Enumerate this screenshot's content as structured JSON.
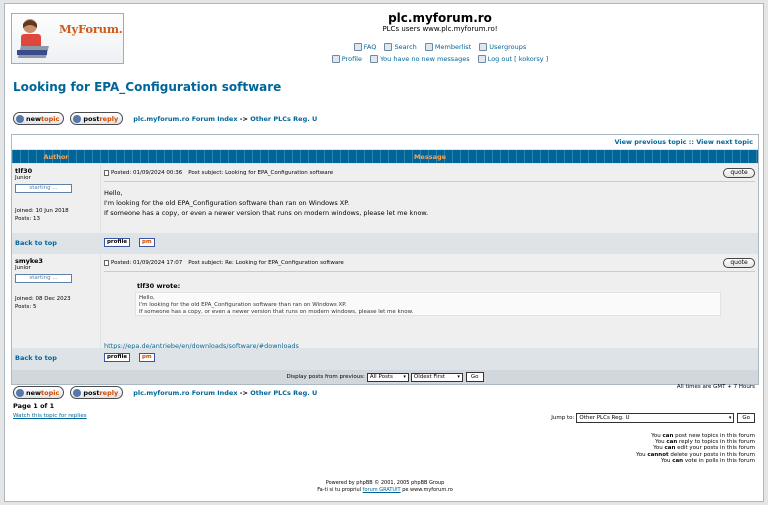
{
  "header": {
    "logo_text": "MyForum.ro",
    "site_title": "plc.myforum.ro",
    "site_description": "PLCs users www.plc.myforum.ro!",
    "nav_row1": [
      {
        "label": "FAQ",
        "icon": "faq-icon"
      },
      {
        "label": "Search",
        "icon": "search-icon"
      },
      {
        "label": "Memberlist",
        "icon": "memberlist-icon"
      },
      {
        "label": "Usergroups",
        "icon": "usergroups-icon"
      }
    ],
    "nav_row2": [
      {
        "label": "Profile",
        "icon": "profile-icon"
      },
      {
        "label": "You have no new messages",
        "icon": "messages-icon"
      },
      {
        "label": "Log out [ kokorsy ]",
        "icon": "logout-icon"
      }
    ]
  },
  "topic": {
    "title": "Looking for EPA_Configuration software",
    "newtopic_label": "newtopic",
    "newtopic_prefix": "new",
    "newtopic_suffix": "topic",
    "postreply_prefix": "post",
    "postreply_suffix": "reply"
  },
  "breadcrumb": {
    "index": "plc.myforum.ro Forum Index",
    "separator": "->",
    "forum": "Other PLCs Reg. U"
  },
  "table": {
    "view_previous": "View previous topic",
    "separator": "::",
    "view_next": "View next topic",
    "col_author": "Author",
    "col_message": "Message"
  },
  "posts": [
    {
      "author": "tlf30",
      "rank": "Junior",
      "rank_badge": "starting ...",
      "joined": "Joined: 10 Jun 2018",
      "posts": "Posts: 13",
      "posted": "Posted: 01/09/2024 00:36",
      "subject": "Post subject: Looking for EPA_Configuration software",
      "lines": [
        "Hello,",
        "I'm looking for the old EPA_Configuration software than ran on Windows XP.",
        "If someone has a copy, or even a newer version that runs on modern windows, please let me know."
      ]
    },
    {
      "author": "smyke3",
      "rank": "Junior",
      "rank_badge": "starting ...",
      "joined": "Joined: 08 Dec 2023",
      "posts": "Posts: 5",
      "posted": "Posted: 01/09/2024 17:07",
      "subject": "Post subject: Re: Looking for EPA_Configuration software",
      "quote_author": "tlf30 wrote:",
      "quote_lines": [
        "Hello,",
        "I'm looking for the old EPA_Configuration software than ran on Windows XP.",
        "If someone has a copy, or even a newer version that runs on modern windows, please let me know."
      ],
      "link": "https://epa.de/antriebe/en/downloads/software/#downloads"
    }
  ],
  "post_actions": {
    "quote": "quote",
    "profile": "profile",
    "pm": "pm",
    "back_to_top": "Back to top"
  },
  "display": {
    "label": "Display posts from previous:",
    "posts_option": "All Posts",
    "order_option": "Oldest First",
    "go": "Go"
  },
  "bottom": {
    "timezone": "All times are GMT + 7 Hours",
    "page_info": "Page 1 of 1",
    "watch": "Watch this topic for replies",
    "jump_label": "Jump to:",
    "jump_option": "Other PLCs Reg. U",
    "go": "Go"
  },
  "permissions": [
    {
      "pre": "You ",
      "verb": "can",
      "post": " post new topics in this forum"
    },
    {
      "pre": "You ",
      "verb": "can",
      "post": " reply to topics in this forum"
    },
    {
      "pre": "You ",
      "verb": "can",
      "post": " edit your posts in this forum"
    },
    {
      "pre": "You ",
      "verb": "cannot",
      "post": " delete your posts in this forum"
    },
    {
      "pre": "You ",
      "verb": "can",
      "post": " vote in polls in this forum"
    }
  ],
  "footer": {
    "line1": "Powered by phpBB © 2001, 2005 phpBB Group",
    "line2_pre": "Fa-ti si tu propriul ",
    "line2_link": "forum GRATUIT",
    "line2_post": " pe www.myforum.ro"
  },
  "colors": {
    "link": "#006699",
    "header_bar": "#006699",
    "header_text": "#ffa34f",
    "row_light": "#efefef",
    "row_dark": "#dee3e7"
  }
}
